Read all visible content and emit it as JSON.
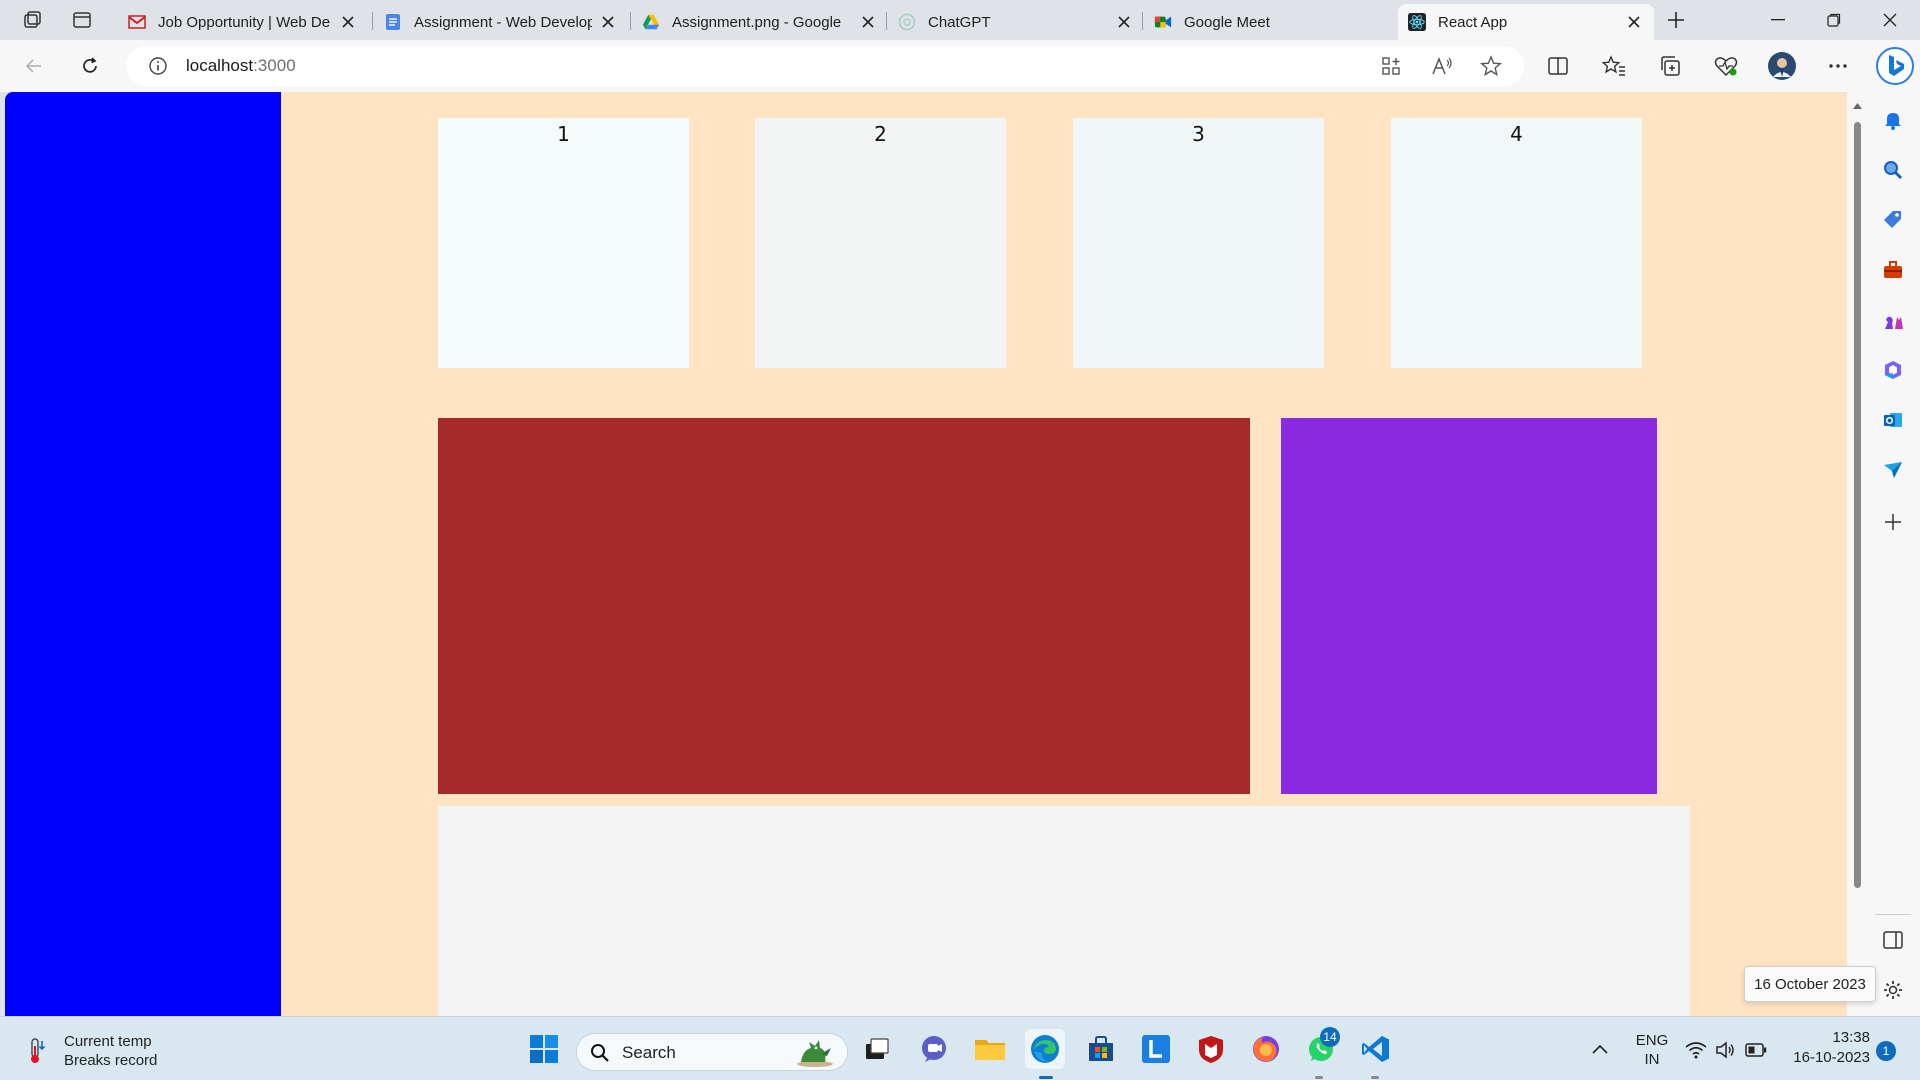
{
  "browser": {
    "tabs": [
      {
        "label": "Job Opportunity | Web De",
        "icon": "gmail-icon"
      },
      {
        "label": "Assignment - Web Develop",
        "icon": "docs-icon"
      },
      {
        "label": "Assignment.png - Google",
        "icon": "drive-icon"
      },
      {
        "label": "ChatGPT",
        "icon": "chatgpt-icon"
      },
      {
        "label": "Google Meet",
        "icon": "meet-icon"
      },
      {
        "label": "React App",
        "icon": "react-icon",
        "active": true
      }
    ],
    "url": "localhost:3000",
    "url_host": "localhost",
    "url_port": ":3000"
  },
  "page": {
    "cards": [
      "1",
      "2",
      "3",
      "4"
    ],
    "colors": {
      "background": "#ffe4c4",
      "left_panel": "#0000ff",
      "card_1": "#f5fbfb",
      "card_2": "#f3f5f5",
      "card_3": "#f1f7f7",
      "card_4": "#f2f8f8",
      "red_block": "#a52a2a",
      "purple_block": "#8a2be2",
      "bottom_block": "#f4f4f4"
    }
  },
  "tooltip": {
    "date": "16 October 2023"
  },
  "taskbar": {
    "weather": {
      "line1": "Current temp",
      "line2": "Breaks record"
    },
    "search_label": "Search",
    "whatsapp_badge": "14",
    "language": {
      "line1": "ENG",
      "line2": "IN"
    },
    "clock": {
      "time": "13:38",
      "date": "16-10-2023"
    },
    "notification_count": "1"
  }
}
